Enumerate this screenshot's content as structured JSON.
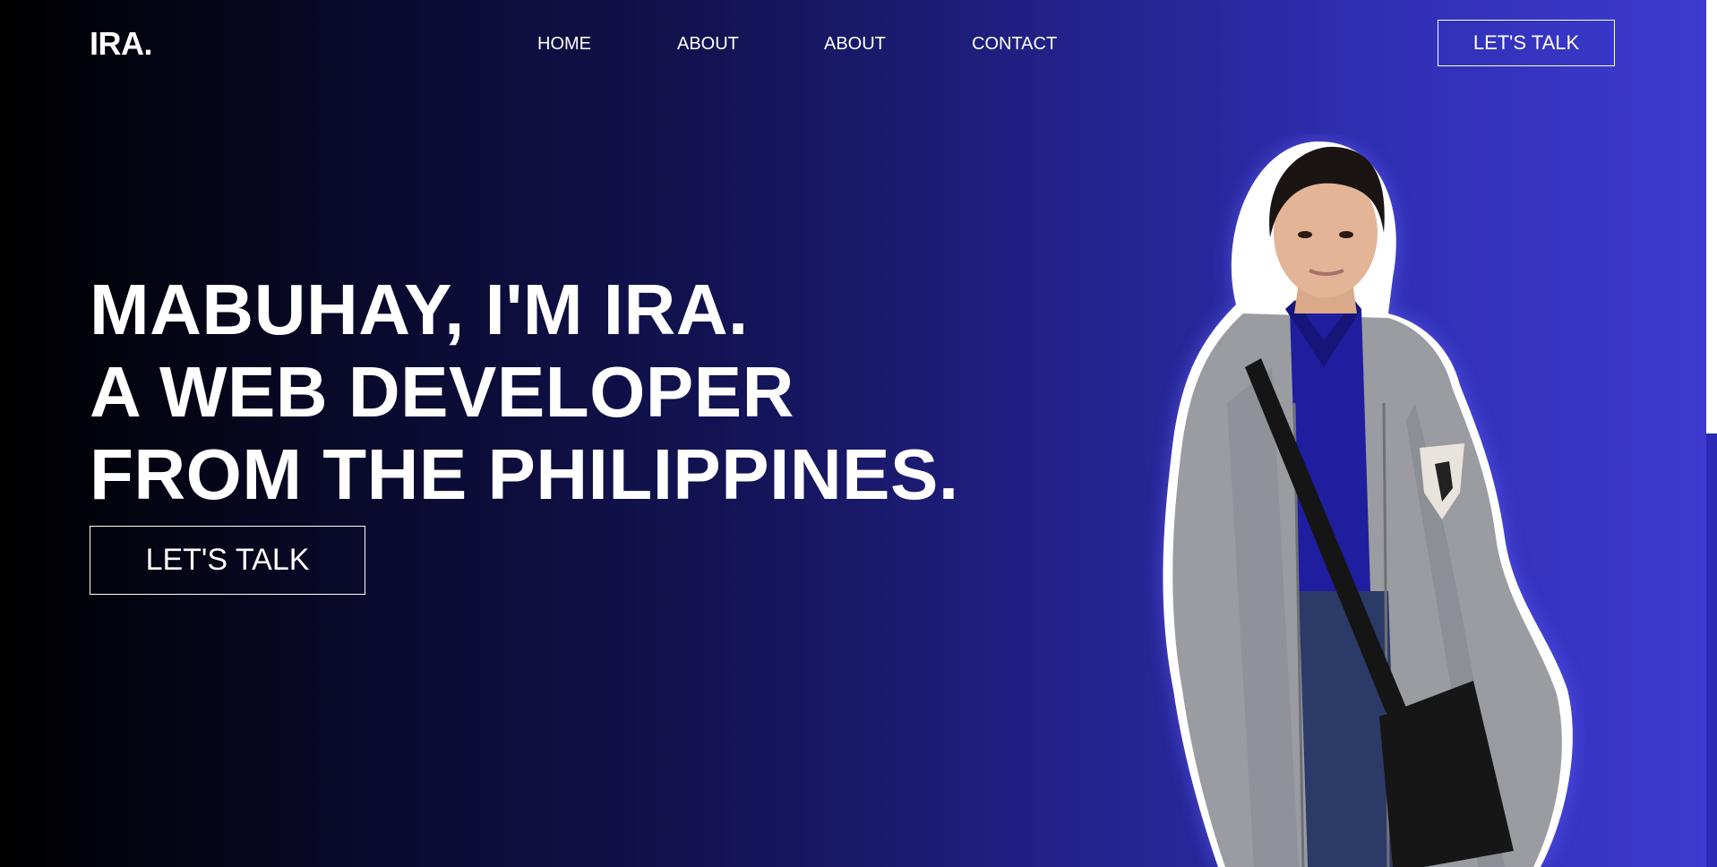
{
  "header": {
    "logo": "IRA.",
    "nav": [
      "HOME",
      "ABOUT",
      "ABOUT",
      "CONTACT"
    ],
    "cta_label": "LET'S TALK"
  },
  "hero": {
    "lines": [
      "MABUHAY, I'M IRA.",
      "A WEB DEVELOPER",
      "FROM THE PHILIPPINES."
    ],
    "cta_label": "LET'S TALK"
  },
  "colors": {
    "background_start": "#000000",
    "background_end": "#3d3ad0",
    "text": "#ffffff",
    "hoodie": "#9a9ca2",
    "shirt": "#1e1e9e"
  },
  "icons": {
    "portrait": "portrait-photo"
  }
}
